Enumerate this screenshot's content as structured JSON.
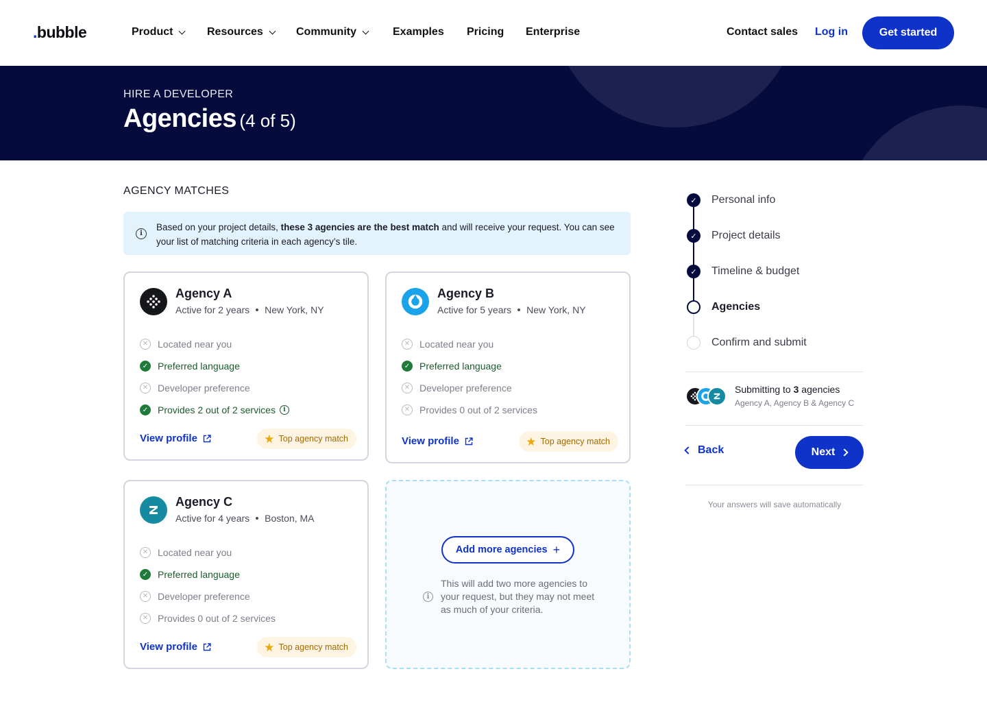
{
  "nav": {
    "logo": "bubble",
    "items": [
      {
        "label": "Product",
        "dropdown": true
      },
      {
        "label": "Resources",
        "dropdown": true
      },
      {
        "label": "Community",
        "dropdown": true
      },
      {
        "label": "Examples",
        "dropdown": false
      },
      {
        "label": "Pricing",
        "dropdown": false
      },
      {
        "label": "Enterprise",
        "dropdown": false
      }
    ],
    "contact_sales": "Contact sales",
    "login": "Log in",
    "get_started": "Get started"
  },
  "hero": {
    "eyebrow": "HIRE A DEVELOPER",
    "title": "Agencies",
    "step_count": "(4 of 5)"
  },
  "main": {
    "section_title": "AGENCY MATCHES",
    "banner": {
      "text_before": "Based on your project details, ",
      "text_bold": "these 3 agencies are the best match",
      "text_after": " and will receive your request. You can see your list of matching criteria in each agency’s tile."
    },
    "agencies": [
      {
        "name": "Agency A",
        "active": "Active for 2 years",
        "location": "New York, NY",
        "logo_icon": "dots-logo-icon",
        "logo_color": "#16171d",
        "criteria": [
          {
            "label": "Located near you",
            "met": false
          },
          {
            "label": "Preferred language",
            "met": true
          },
          {
            "label": "Developer preference",
            "met": false
          },
          {
            "label": "Provides 2 out of 2 services",
            "met": true,
            "info": true
          }
        ],
        "view_profile": "View profile",
        "badge": "Top agency match"
      },
      {
        "name": "Agency B",
        "active": "Active for 5 years",
        "location": "New York, NY",
        "logo_icon": "ring-logo-icon",
        "logo_color": "#1aa3e8",
        "criteria": [
          {
            "label": "Located near you",
            "met": false
          },
          {
            "label": "Preferred language",
            "met": true
          },
          {
            "label": "Developer preference",
            "met": false
          },
          {
            "label": "Provides 0 out of 2 services",
            "met": false
          }
        ],
        "view_profile": "View profile",
        "badge": "Top agency match"
      },
      {
        "name": "Agency C",
        "active": "Active for 4 years",
        "location": "Boston, MA",
        "logo_icon": "z-logo-icon",
        "logo_color": "#168aa0",
        "criteria": [
          {
            "label": "Located near you",
            "met": false
          },
          {
            "label": "Preferred language",
            "met": true
          },
          {
            "label": "Developer preference",
            "met": false
          },
          {
            "label": "Provides 0 out of 2 services",
            "met": false
          }
        ],
        "view_profile": "View profile",
        "badge": "Top agency match"
      }
    ],
    "add_more": {
      "button": "Add more agencies",
      "note": "This will add two more agencies to your request, but they may not meet as much of your criteria."
    }
  },
  "sidebar": {
    "steps": [
      {
        "label": "Personal info",
        "state": "done"
      },
      {
        "label": "Project details",
        "state": "done"
      },
      {
        "label": "Timeline & budget",
        "state": "done"
      },
      {
        "label": "Agencies",
        "state": "current"
      },
      {
        "label": "Confirm and submit",
        "state": "todo"
      }
    ],
    "submitting_prefix": "Submitting to ",
    "submitting_count": "3",
    "submitting_suffix": " agencies",
    "submitting_names": "Agency A, Agency B & Agency C",
    "back": "Back",
    "next": "Next",
    "autosave": "Your answers will save automatically"
  },
  "colors": {
    "brand_blue": "#0f32c8",
    "hero_navy": "#050b3d",
    "success_green": "#207a3a",
    "badge_bg": "#fdf4e3",
    "banner_bg": "#e2f3fb"
  }
}
